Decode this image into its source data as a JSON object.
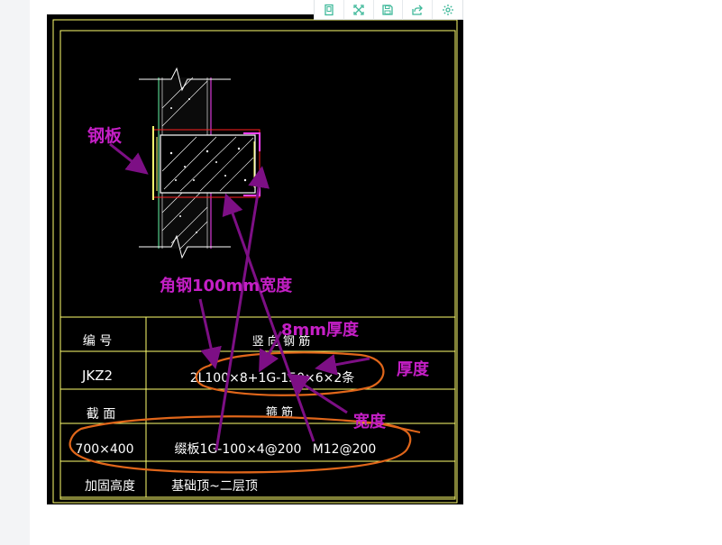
{
  "toolbar": {
    "buttons": [
      {
        "name": "page-icon"
      },
      {
        "name": "fullscreen-icon"
      },
      {
        "name": "save-icon"
      },
      {
        "name": "share-icon"
      },
      {
        "name": "gear-icon"
      }
    ]
  },
  "table": {
    "row1_label": "编 号",
    "row1_header": "竖 向 钢 筋",
    "row2_label": "JKZ2",
    "row2_value": "2L100×8+1G-150×6×2条",
    "row3_label": "截 面",
    "row3_header": "箍 筋",
    "row4_label": "700×400",
    "row4_value_left": "缀板1G-100×4@200",
    "row4_value_right": "M12@200",
    "row5_label": "加固高度",
    "row5_value": "基础顶~二层顶"
  },
  "annotations": {
    "steel_plate": "钢板",
    "angle_width": "角钢100mm宽度",
    "thickness_8mm": "8mm厚度",
    "thickness": "厚度",
    "width": "宽度"
  },
  "colors": {
    "annotation": "#c51fc6",
    "arrow": "#7d0f85",
    "ellipse": "#e0661a",
    "cad_frame": "#ffff6e",
    "cad_white": "#ffffff",
    "cad_red": "#ff2020",
    "cad_green": "#5ff0a0",
    "cad_magenta": "#ff40ff"
  }
}
